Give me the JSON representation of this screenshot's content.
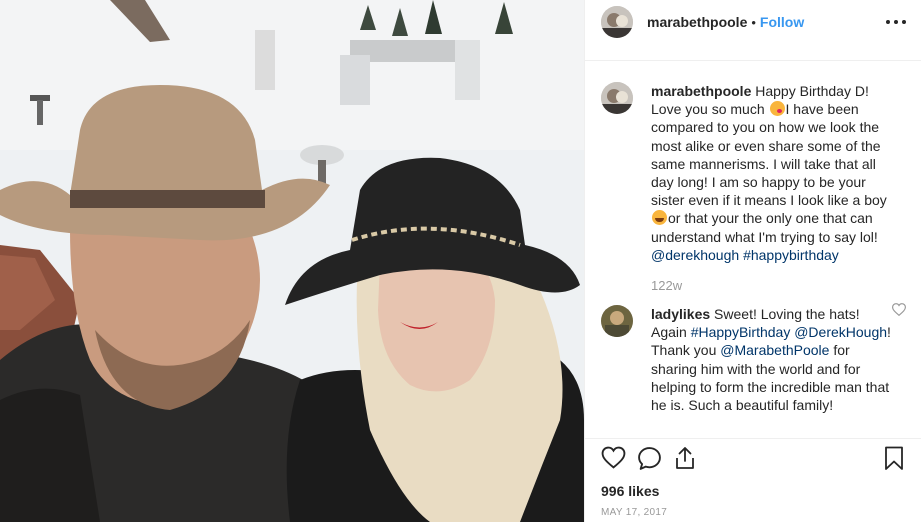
{
  "header": {
    "username": "marabethpoole",
    "separator": "•",
    "follow_label": "Follow"
  },
  "caption": {
    "username": "marabethpoole",
    "part1": "Happy Birthday D! Love you so much ",
    "emoji1": "face-blowing-kiss",
    "part2": "I have been compared to you on how we look the most alike or even share some of the same mannerisms. I will take that all day long! I am so happy to be your sister even if it means I look like a boy ",
    "emoji2": "face-with-tears-of-joy",
    "part3": "or that your the only one that can understand what I'm trying to say lol!",
    "mention": "@derekhough",
    "hashtag": "#happybirthday",
    "time": "122w"
  },
  "reply": {
    "username": "ladylikes",
    "part1": "Sweet! Loving the hats! Again ",
    "hashtag": "#HappyBirthday",
    "mention1": "@DerekHough",
    "part2": "! Thank you ",
    "mention2": "@MarabethPoole",
    "part3": " for sharing him with the world and for helping to form the incredible man that he is. Such a beautiful family!"
  },
  "actions": {
    "like": "heart-icon",
    "comment": "comment-bubble-icon",
    "share": "share-icon",
    "save": "bookmark-icon"
  },
  "likes_text": "996 likes",
  "date_text": "MAY 17, 2017",
  "colors": {
    "link": "#003569",
    "follow": "#3897f0",
    "muted": "#999999",
    "text": "#262626"
  }
}
